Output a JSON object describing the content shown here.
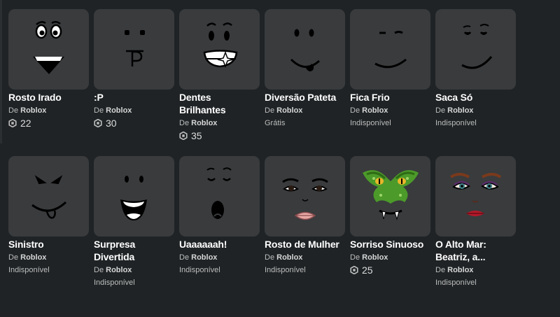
{
  "items": [
    {
      "name": "Rosto Irado",
      "by": "De ",
      "creator": "Roblox",
      "price": "22",
      "price_type": "robux",
      "icon": "angry-face-icon"
    },
    {
      "name": ":P",
      "by": "De ",
      "creator": "Roblox",
      "price": "30",
      "price_type": "robux",
      "icon": "tongue-out-face-icon"
    },
    {
      "name": "Dentes Brilhantes",
      "by": "De ",
      "creator": "Roblox",
      "price": "35",
      "price_type": "robux",
      "icon": "shiny-teeth-face-icon"
    },
    {
      "name": "Diversão Pateta",
      "by": "De ",
      "creator": "Roblox",
      "price": "Grátis",
      "price_type": "text",
      "icon": "goofy-face-icon"
    },
    {
      "name": "Fica Frio",
      "by": "De ",
      "creator": "Roblox",
      "price": "Indisponível",
      "price_type": "text",
      "icon": "chill-face-icon"
    },
    {
      "name": "Saca Só",
      "by": "De ",
      "creator": "Roblox",
      "price": "Indisponível",
      "price_type": "text",
      "icon": "check-it-face-icon"
    },
    {
      "name": "Sinistro",
      "by": "De ",
      "creator": "Roblox",
      "price": "Indisponível",
      "price_type": "text",
      "icon": "sinister-face-icon"
    },
    {
      "name": "Surpresa Divertida",
      "by": "De ",
      "creator": "Roblox",
      "price": "Indisponível",
      "price_type": "text",
      "icon": "fun-surprise-face-icon"
    },
    {
      "name": "Uaaaaaah!",
      "by": "De ",
      "creator": "Roblox",
      "price": "Indisponível",
      "price_type": "text",
      "icon": "yawn-face-icon"
    },
    {
      "name": "Rosto de Mulher",
      "by": "De ",
      "creator": "Roblox",
      "price": "Indisponível",
      "price_type": "text",
      "icon": "woman-face-icon"
    },
    {
      "name": "Sorriso Sinuoso",
      "by": "De ",
      "creator": "Roblox",
      "price": "25",
      "price_type": "robux",
      "icon": "snake-smile-face-icon"
    },
    {
      "name": "O Alto Mar: Beatriz, a...",
      "by": "De ",
      "creator": "Roblox",
      "price": "Indisponível",
      "price_type": "text",
      "icon": "high-seas-beatrix-face-icon"
    }
  ],
  "colors": {
    "background": "#1f2325",
    "card": "#393b3d",
    "robux_icon": "#bdbebe"
  }
}
